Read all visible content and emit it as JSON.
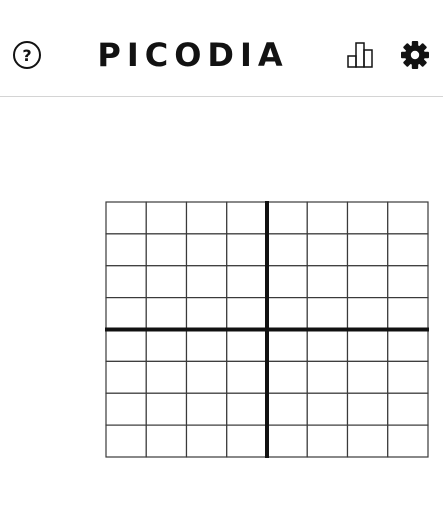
{
  "header": {
    "title": "PICODIA",
    "help_icon": "question-circle-icon",
    "stats_icon": "bar-chart-icon",
    "settings_icon": "gear-icon"
  },
  "board": {
    "rows": 8,
    "cols": 8,
    "filled_cells": [],
    "grid_color": "#3a3a3a",
    "thick_line_color": "#111111"
  }
}
